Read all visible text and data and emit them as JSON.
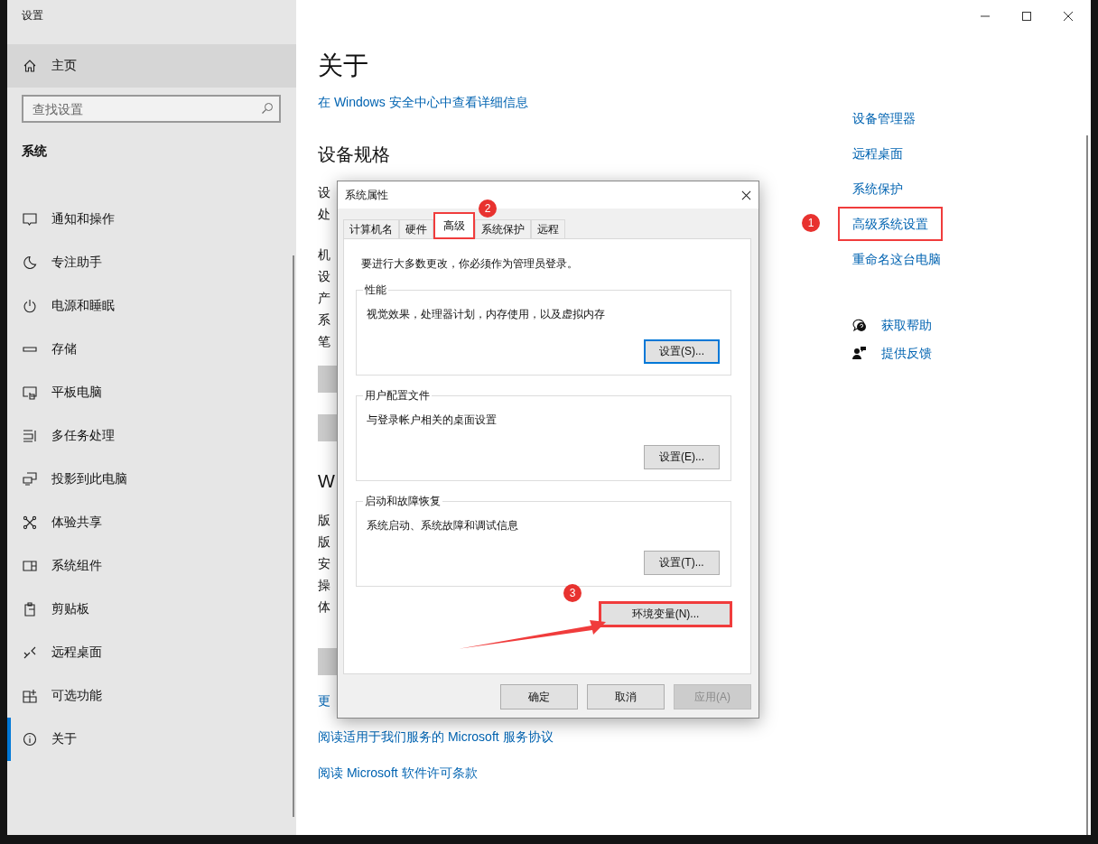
{
  "settings_window": {
    "title": "设置"
  },
  "sidebar": {
    "home": {
      "label": "主页",
      "hovered": true
    },
    "search": {
      "placeholder": "查找设置"
    },
    "section_title": "系统",
    "items": [
      {
        "label": "通知和操作",
        "selected": false
      },
      {
        "label": "专注助手",
        "selected": false
      },
      {
        "label": "电源和睡眠",
        "selected": false
      },
      {
        "label": "存储",
        "selected": false
      },
      {
        "label": "平板电脑",
        "selected": false
      },
      {
        "label": "多任务处理",
        "selected": false
      },
      {
        "label": "投影到此电脑",
        "selected": false
      },
      {
        "label": "体验共享",
        "selected": false
      },
      {
        "label": "系统组件",
        "selected": false
      },
      {
        "label": "剪贴板",
        "selected": false
      },
      {
        "label": "远程桌面",
        "selected": false
      },
      {
        "label": "可选功能",
        "selected": false
      },
      {
        "label": "关于",
        "selected": true
      }
    ]
  },
  "main": {
    "title": "关于",
    "security_link": "在 Windows 安全中心中查看详细信息",
    "groups": [
      [
        {
          "kind": "heading",
          "text": "设备规格"
        }
      ],
      [
        {
          "kind": "text",
          "text": "设"
        },
        {
          "kind": "text",
          "text": "处"
        }
      ],
      [
        {
          "kind": "text",
          "text": "机"
        },
        {
          "kind": "text",
          "text": "设"
        },
        {
          "kind": "text",
          "text": "产"
        },
        {
          "kind": "text",
          "text": "系"
        },
        {
          "kind": "text",
          "text": "笔"
        },
        {
          "kind": "button"
        },
        {
          "kind": "button"
        }
      ],
      [
        {
          "kind": "heading",
          "text": "W"
        }
      ],
      [
        {
          "kind": "text",
          "text": "版"
        },
        {
          "kind": "text",
          "text": "版"
        },
        {
          "kind": "text",
          "text": "安"
        },
        {
          "kind": "text",
          "text": "操"
        },
        {
          "kind": "text",
          "text": "体"
        },
        {
          "kind": "button"
        }
      ],
      [
        {
          "kind": "link",
          "text": "更"
        }
      ]
    ],
    "links": [
      "阅读适用于我们服务的 Microsoft 服务协议",
      "阅读 Microsoft 软件许可条款"
    ]
  },
  "related": {
    "links": [
      {
        "label": "设备管理器",
        "highlighted": false
      },
      {
        "label": "远程桌面",
        "highlighted": false
      },
      {
        "label": "系统保护",
        "highlighted": false
      },
      {
        "label": "高级系统设置",
        "highlighted": true,
        "marker": "1"
      },
      {
        "label": "重命名这台电脑",
        "highlighted": false
      }
    ],
    "help": [
      "获取帮助",
      "提供反馈"
    ]
  },
  "dialog": {
    "title": "系统属性",
    "tabs": [
      {
        "label": "计算机名",
        "selected": false,
        "highlighted": false
      },
      {
        "label": "硬件",
        "selected": false,
        "highlighted": false
      },
      {
        "label": "高级",
        "selected": true,
        "highlighted": true,
        "marker": "2"
      },
      {
        "label": "系统保护",
        "selected": false,
        "highlighted": false
      },
      {
        "label": "远程",
        "selected": false,
        "highlighted": false
      }
    ],
    "admin_note": "要进行大多数更改，你必须作为管理员登录。",
    "groups": [
      {
        "title": "性能",
        "description": "视觉效果，处理器计划，内存使用，以及虚拟内存",
        "button": {
          "label": "设置(S)...",
          "focused": true
        }
      },
      {
        "title": "用户配置文件",
        "description": "与登录帐户相关的桌面设置",
        "button": {
          "label": "设置(E)...",
          "focused": false
        }
      },
      {
        "title": "启动和故障恢复",
        "description": "系统启动、系统故障和调试信息",
        "button": {
          "label": "设置(T)...",
          "focused": false
        }
      }
    ],
    "env_button": {
      "label": "环境变量(N)...",
      "highlighted": true,
      "marker": "3",
      "arrow": true
    },
    "footer_buttons": [
      {
        "label": "确定",
        "disabled": false
      },
      {
        "label": "取消",
        "disabled": false
      },
      {
        "label": "应用(A)",
        "disabled": true
      }
    ]
  }
}
